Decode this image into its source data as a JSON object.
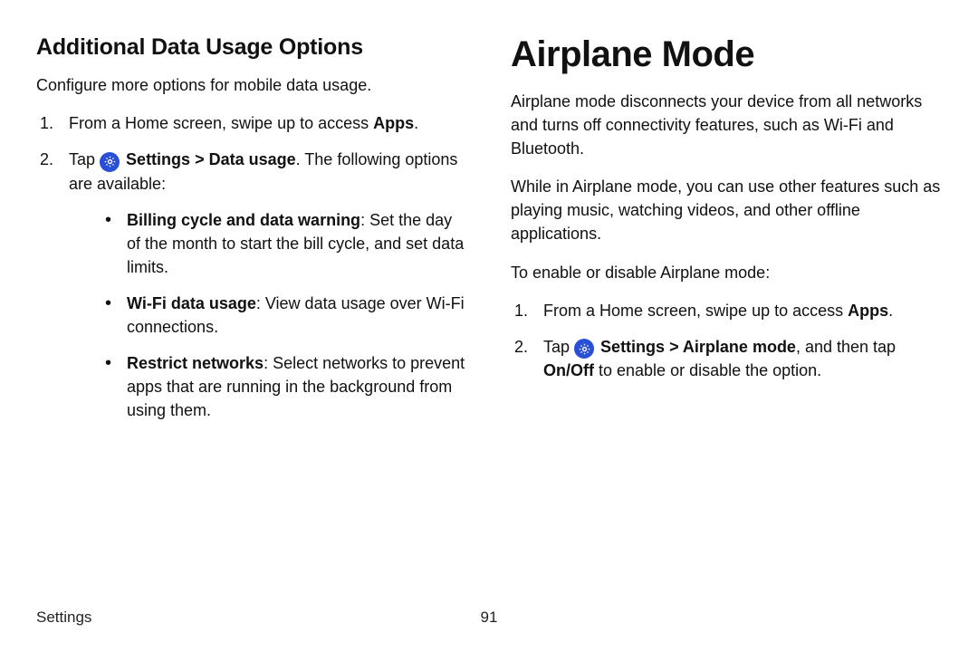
{
  "left": {
    "heading": "Additional Data Usage Options",
    "intro": "Configure more options for mobile data usage.",
    "step1_pre": "From a Home screen, swipe up to access ",
    "step1_bold": "Apps",
    "step1_post": ".",
    "step2_pre": "Tap ",
    "step2_settings": "Settings",
    "step2_gt": " > ",
    "step2_target": "Data usage",
    "step2_post": ". The following options are available:",
    "bullets": [
      {
        "title": "Billing cycle and data warning",
        "desc": ": Set the day of the month to start the bill cycle, and set data limits."
      },
      {
        "title": "Wi-Fi data usage",
        "desc": ": View data usage over Wi-Fi connections."
      },
      {
        "title": "Restrict networks",
        "desc": ": Select networks to prevent apps that are running in the background from using them."
      }
    ]
  },
  "right": {
    "heading": "Airplane Mode",
    "p1": "Airplane mode disconnects your device from all networks and turns off connectivity features, such as Wi-Fi and Bluetooth.",
    "p2": "While in Airplane mode, you can use other features such as playing music, watching videos, and other offline applications.",
    "p3": "To enable or disable Airplane mode:",
    "step1_pre": "From a Home screen, swipe up to access ",
    "step1_bold": "Apps",
    "step1_post": ".",
    "step2_pre": "Tap ",
    "step2_settings": "Settings",
    "step2_gt": " > ",
    "step2_target": "Airplane mode",
    "step2_mid": ", and then tap ",
    "step2_onoff": "On/Off",
    "step2_post": " to enable or disable the option."
  },
  "footer": {
    "section": "Settings",
    "page": "91"
  }
}
